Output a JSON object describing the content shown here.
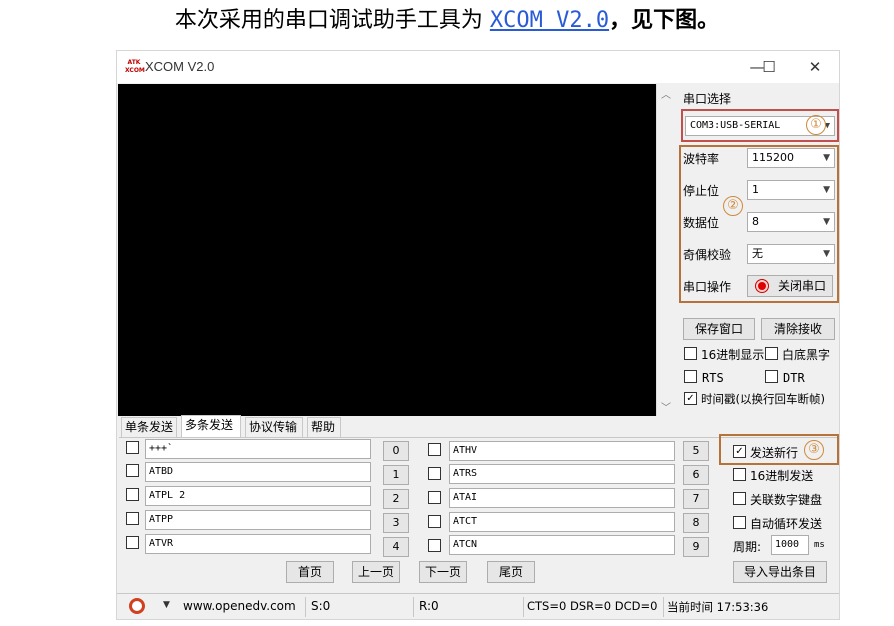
{
  "doc": {
    "prefix": "本次采用的串口调试助手工具为 ",
    "link": "XCOM V2.0",
    "suffix": "，见下图。"
  },
  "window": {
    "logo_top": "ATK",
    "logo_bottom": "XCOM",
    "title": "XCOM V2.0",
    "min": "—",
    "max": "☐",
    "close": "✕"
  },
  "serial": {
    "port_label": "串口选择",
    "port_value": "COM3:USB-SERIAL",
    "baud_label": "波特率",
    "baud_value": "115200",
    "stop_label": "停止位",
    "stop_value": "1",
    "data_label": "数据位",
    "data_value": "8",
    "parity_label": "奇偶校验",
    "parity_value": "无",
    "op_label": "串口操作",
    "op_button": "关闭串口"
  },
  "annotations": {
    "one": "①",
    "two": "②",
    "three": "③"
  },
  "actions": {
    "save_window": "保存窗口",
    "clear_recv": "清除接收",
    "hex_display": "16进制显示",
    "white_black": "白底黑字",
    "rts": "RTS",
    "dtr": "DTR",
    "timestamp": "时间戳(以换行回车断帧)"
  },
  "tabs": [
    "单条发送",
    "多条发送",
    "协议传输",
    "帮助"
  ],
  "multi_send": {
    "left": [
      {
        "value": "+++`",
        "num": "0"
      },
      {
        "value": "ATBD",
        "num": "1"
      },
      {
        "value": "ATPL 2",
        "num": "2"
      },
      {
        "value": "ATPP",
        "num": "3"
      },
      {
        "value": "ATVR",
        "num": "4"
      }
    ],
    "right": [
      {
        "value": "ATHV",
        "num": "5"
      },
      {
        "value": "ATRS",
        "num": "6"
      },
      {
        "value": "ATAI",
        "num": "7"
      },
      {
        "value": "ATCT",
        "num": "8"
      },
      {
        "value": "ATCN",
        "num": "9"
      }
    ],
    "send_newline": "发送新行",
    "hex_send": "16进制发送",
    "link_keypad": "关联数字键盘",
    "auto_loop": "自动循环发送",
    "period_label": "周期:",
    "period_value": "1000",
    "period_unit": "ms",
    "first": "首页",
    "prev": "上一页",
    "next": "下一页",
    "last": "尾页",
    "import_export": "导入导出条目"
  },
  "status": {
    "url": "www.openedv.com",
    "s": "S:0",
    "r": "R:0",
    "lines": "CTS=0 DSR=0 DCD=0",
    "time": "当前时间 17:53:36"
  },
  "colors": {
    "console_bg": "#000000",
    "highlight_red": "#c0504d",
    "highlight_brown": "#b7723a",
    "link_blue": "#2a5bd7"
  }
}
